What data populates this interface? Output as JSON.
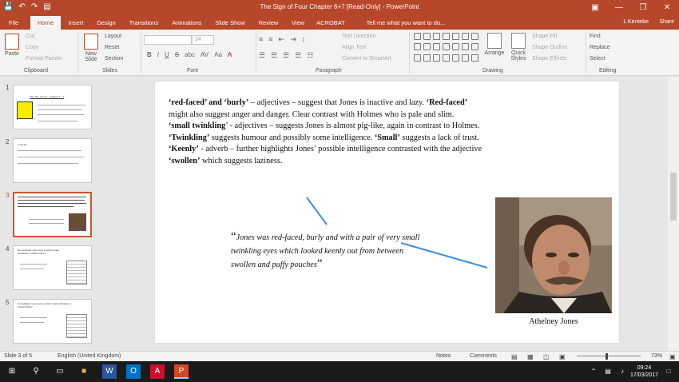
{
  "window": {
    "title": "The Sign of Four  Chapter 6+7 [Read-Only]  -  PowerPoint",
    "qat": [
      "💾",
      "↶",
      "↷",
      "▤"
    ],
    "controls": [
      "▣",
      "—",
      "❐",
      "✕"
    ]
  },
  "tabs": [
    "File",
    "Home",
    "Insert",
    "Design",
    "Transitions",
    "Animations",
    "Slide Show",
    "Review",
    "View",
    "ACROBAT",
    "Tell me what you want to do..."
  ],
  "user": "L Kentebe",
  "share": "Share",
  "ribbon": {
    "clipboard": {
      "paste": "Paste",
      "cut": "Cut",
      "copy": "Copy",
      "format_painter": "Format Painter",
      "label": "Clipboard"
    },
    "slides": {
      "new_slide": "New Slide",
      "layout": "Layout",
      "reset": "Reset",
      "section": "Section",
      "label": "Slides"
    },
    "font": {
      "font_name": "",
      "font_size": "24",
      "bold": "B",
      "italic": "I",
      "underline": "U",
      "strike": "S",
      "shadow": "abc",
      "spacing": "AV",
      "case": "Aa",
      "color": "A",
      "label": "Font"
    },
    "paragraph": {
      "text_direction": "Text Direction",
      "align_text": "Align Text",
      "smartart": "Convert to SmartArt",
      "label": "Paragraph"
    },
    "drawing": {
      "arrange": "Arrange",
      "quick_styles": "Quick Styles",
      "shape_fill": "Shape Fill",
      "shape_outline": "Shape Outline",
      "shape_effects": "Shape Effects",
      "label": "Drawing"
    },
    "editing": {
      "find": "Find",
      "replace": "Replace",
      "select": "Select",
      "label": "Editing"
    }
  },
  "thumbnails": [
    {
      "num": "1",
      "title": "The Sign of Four - Chapter 6 + 7"
    },
    {
      "num": "2",
      "title": "In Small"
    },
    {
      "num": "3",
      "title": ""
    },
    {
      "num": "4",
      "title": "Demonstrate: How does a writer create characters / relationships?"
    },
    {
      "num": "5",
      "title": "Consolidate: How does a writer create characters / relationships?"
    }
  ],
  "slide": {
    "body": {
      "p1_bold1": "‘red-faced’ and ‘burly’",
      "p1_text1": " – adjectives – suggest that Jones is inactive and lazy. ",
      "p1_bold2": "‘Red-faced’",
      "p1_text2": " might also suggest anger and danger. Clear contrast with Holmes who is pale and slim.",
      "p2_bold1": "‘small twinkling",
      "p2_text1": "’ - adjectives – suggests Jones is almost pig-like, again in contrast to Holmes. ",
      "p2_bold2": "‘Twinkling’",
      "p2_text2": " suggests humour and possibly some intelligence. ",
      "p2_bold3": "‘Small’",
      "p2_text3": " suggests a lack of trust.",
      "p3_bold1": "‘Keenly’",
      "p3_text1": " - adverb – further highlights Jones’ possible intelligence contrasted with the adjective ",
      "p3_bold2": "‘swollen’",
      "p3_text2": " which suggests laziness."
    },
    "quote": {
      "open": "“",
      "text": "Jones was red-faced, burly and with a pair of very small twinkling eyes which looked keenly out from between swollen and puffy pouches",
      "close": "”"
    },
    "caption": "Athelney Jones"
  },
  "status": {
    "slide_count": "Slide 3 of 5",
    "language": "English (United Kingdom)",
    "notes": "Notes",
    "comments": "Comments",
    "zoom": "73%"
  },
  "taskbar": {
    "time": "09:24",
    "date": "17/03/2017"
  },
  "colors": {
    "accent": "#b7472a",
    "slide_line": "#3b8fd6"
  }
}
